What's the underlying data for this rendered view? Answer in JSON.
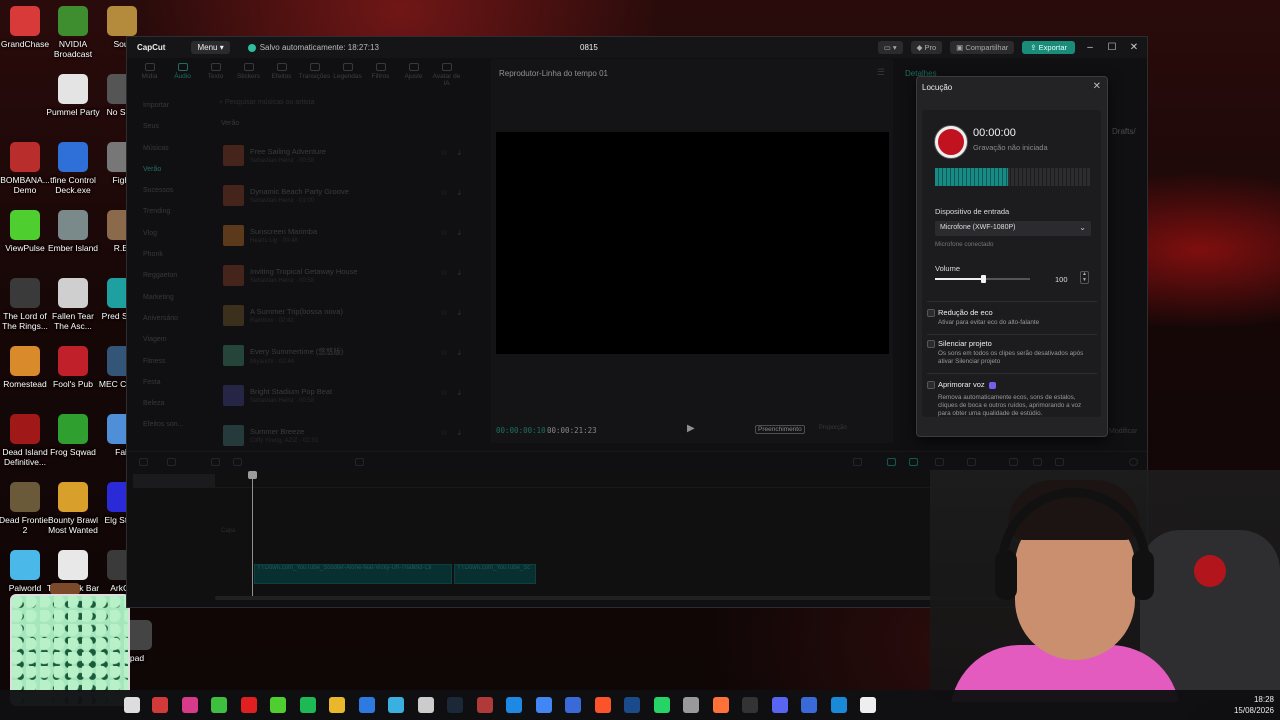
{
  "desktop": {
    "icons": [
      {
        "label": "GrandChase",
        "color": "#d83a3a"
      },
      {
        "label": "NVIDIA Broadcast",
        "color": "#3e8e2f"
      },
      {
        "label": "Soul",
        "color": "#b48a3c"
      },
      {
        "label": "Pummel Party",
        "color": "#e4e4e4"
      },
      {
        "label": "No Surv",
        "color": "#555555"
      },
      {
        "label": "BOMBANA... Demo",
        "color": "#b92d2d"
      },
      {
        "label": "tfine Control Deck.exe",
        "color": "#2f6fd8"
      },
      {
        "label": "Fight",
        "color": "#777777"
      },
      {
        "label": "ViewPulse",
        "color": "#4fcf2f"
      },
      {
        "label": "Ember Island",
        "color": "#7a8a8a"
      },
      {
        "label": "R.E.",
        "color": "#8a6a4a"
      },
      {
        "label": "The Lord of The Rings...",
        "color": "#3a3a3a"
      },
      {
        "label": "Fallen Tear The Asc...",
        "color": "#cfcfcf"
      },
      {
        "label": "Pred Strea",
        "color": "#1fa0a0"
      },
      {
        "label": "Romestead",
        "color": "#d98a2a"
      },
      {
        "label": "Fool's Pub",
        "color": "#c0202a"
      },
      {
        "label": "MEC CHAM",
        "color": "#335577"
      },
      {
        "label": "Dead Island Definitive...",
        "color": "#a01818"
      },
      {
        "label": "Frog Sqwad",
        "color": "#2fa02f"
      },
      {
        "label": "Fall",
        "color": "#4f8fd8"
      },
      {
        "label": "Dead Frontier 2",
        "color": "#6a5a3a"
      },
      {
        "label": "Bounty Brawl Most Wanted",
        "color": "#d8a02a"
      },
      {
        "label": "Elg Strea",
        "color": "#2a2ad8"
      },
      {
        "label": "Palworld",
        "color": "#4ab8e8"
      },
      {
        "label": "TPU Task Bar",
        "color": "#e8e8e8"
      },
      {
        "label": "ArkCri",
        "color": "#3a3a3a"
      },
      {
        "label": "pad",
        "color": "#444444"
      }
    ]
  },
  "app": {
    "logo": "CapCut",
    "menu_label": "Menu",
    "autosave": "Salvo automaticamente: 18:27:13",
    "project_title": "0815",
    "pro_label": "Pro",
    "share_label": "Compartilhar",
    "export_label": "Exportar",
    "tools": [
      "Mídia",
      "Áudio",
      "Texto",
      "Stickers",
      "Efeitos",
      "Transições",
      "Legendas",
      "Filtros",
      "Ajuste",
      "Avatar de IA"
    ],
    "nav": [
      "Importar",
      "Seus",
      "Músicas",
      "Verão",
      "Sucessos",
      "Trending",
      "Vlog",
      "Phonk",
      "Reggaeton",
      "Marketing",
      "Aniversário",
      "Viagem",
      "Fitness",
      "Festa",
      "Beleza",
      "Efeitos son..."
    ],
    "search_placeholder": "Pesquisar músicas ou artista",
    "section_label": "Verão",
    "music": [
      {
        "title": "Free Sailing Adventure",
        "sub": "Sebastian Heinz · 00:58",
        "color": "#6b3a2a"
      },
      {
        "title": "Dynamic Beach Party Groove",
        "sub": "Sebastian Heinz · 01:00",
        "color": "#6b3a2a"
      },
      {
        "title": "Sunscreen Marimba",
        "sub": "Hearts Lig · 00:48",
        "color": "#8a5a2a"
      },
      {
        "title": "Inviting Tropical Getaway House",
        "sub": "Sebastian Heinz · 00:58",
        "color": "#6b3a2a"
      },
      {
        "title": "A Summer Trip(bossa nova)",
        "sub": "Rainbow · 02:41",
        "color": "#5a4a2a"
      },
      {
        "title": "Every Summertime (悠悠版)",
        "sub": "Miyauchi · 02:44",
        "color": "#3a6a5a"
      },
      {
        "title": "Bright Stadium Pop Beat",
        "sub": "Sebastian Heinz · 00:58",
        "color": "#3a3a6a"
      },
      {
        "title": "Summer Breeze",
        "sub": "Cliffy Young, AZIZ · 02:33",
        "color": "#3a5a5a"
      }
    ],
    "player": {
      "title": "Reprodutor-Linha do tempo 01",
      "time_current": "00:00:00:10",
      "time_total": "00:00:21:23",
      "fill_label": "Preenchimento",
      "ratio_label": "Proporção"
    },
    "details_label": "Detalhes",
    "drafts_label": "Drafts/",
    "adjust_label": "Modificar",
    "timeline": {
      "cover_label": "Capa",
      "clip1": "YTDown.com_YouTube_Scooter-Alone-feat-Vicky-Uh-Thatkfid-Cli",
      "clip2": "YTDown.com_YouTube_Sc"
    }
  },
  "voiceover": {
    "title": "Locução",
    "time": "00:00:00",
    "status": "Gravação não iniciada",
    "level_fraction": 0.47,
    "device_label": "Dispositivo de entrada",
    "device_value": "Microfone (XWF-1080P)",
    "device_hint": "Microfone conectado",
    "volume_label": "Volume",
    "volume_value": "100",
    "volume_fraction": 0.5,
    "options": [
      {
        "title": "Redução de eco",
        "desc": "Ativar para evitar eco do alto-falante"
      },
      {
        "title": "Silenciar projeto",
        "desc": "Os sons em todos os clipes serão desativados após ativar Silenciar projeto"
      },
      {
        "title": "Aprimorar voz",
        "desc": "Remova automaticamente ecos, sons de estalos, cliques de boca e outros ruídos, aprimorando a voz para obter uma qualidade de estúdio."
      }
    ]
  },
  "taskbar": {
    "clock_time": "18:28",
    "clock_date": "15/08/2026",
    "apps": [
      "#d23a3a",
      "#d83a8a",
      "#3fbf3f",
      "#e02020",
      "#4fcf2f",
      "#1db954",
      "#e8b82a",
      "#2d7be0",
      "#3ab0e0",
      "#cccccc",
      "#1b2838",
      "#b03a3a",
      "#1e88e5",
      "#4285f4",
      "#3a6ad8",
      "#fb542b",
      "#1a4a8a",
      "#25d366",
      "#999999",
      "#ff7139",
      "#333333",
      "#5865f2",
      "#3a6ad8",
      "#1a8ad8",
      "#eeeeee"
    ]
  }
}
